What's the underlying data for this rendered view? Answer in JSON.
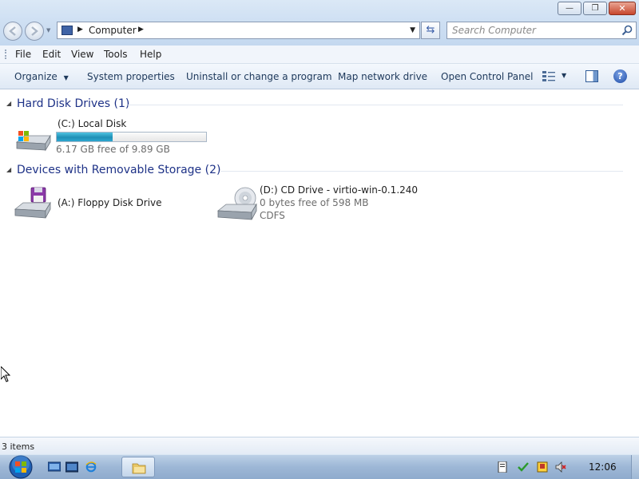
{
  "window": {
    "minimize_glyph": "—",
    "restore_glyph": "❐",
    "close_glyph": "✕"
  },
  "address_bar": {
    "path": "Computer",
    "icon": "computer-icon"
  },
  "search": {
    "placeholder": "Search Computer"
  },
  "menu": {
    "file": "File",
    "edit": "Edit",
    "view": "View",
    "tools": "Tools",
    "help": "Help"
  },
  "toolbar": {
    "organize": "Organize",
    "system_properties": "System properties",
    "uninstall": "Uninstall or change a program",
    "map_drive": "Map network drive",
    "control_panel": "Open Control Panel",
    "help_glyph": "?"
  },
  "groups": {
    "hard_disks": {
      "title": "Hard Disk Drives (1)",
      "items": [
        {
          "name": "(C:) Local Disk",
          "free_text": "6.17 GB free of 9.89 GB",
          "used_fraction": 0.376,
          "icon": "windows-hard-drive-icon"
        }
      ]
    },
    "removable": {
      "title": "Devices with Removable Storage (2)",
      "items": [
        {
          "name": "(A:) Floppy Disk Drive",
          "icon": "floppy-drive-icon"
        },
        {
          "name": "(D:) CD Drive - virtio-win-0.1.240",
          "free_text": "0 bytes free of 598 MB",
          "filesystem": "CDFS",
          "icon": "cd-drive-icon"
        }
      ]
    }
  },
  "status": {
    "item_count": "3 items"
  },
  "taskbar": {
    "time": "12:06"
  },
  "colors": {
    "group_title": "#1e3287",
    "usage_fill": "#2ea6cf",
    "taskbar": "#9db7d6"
  }
}
